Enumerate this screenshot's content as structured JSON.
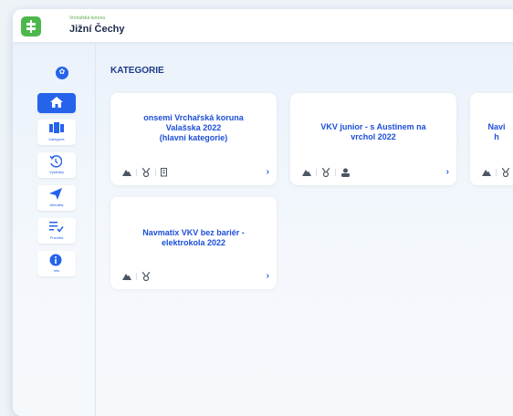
{
  "header": {
    "region_small": "Vrchařská koruna",
    "region_title": "Jižní Čechy"
  },
  "sidebar": {
    "items": [
      {
        "label": ""
      },
      {
        "label": "Kategorie"
      },
      {
        "label": "Výsledky"
      },
      {
        "label": "Aktuality"
      },
      {
        "label": "Pravidla"
      },
      {
        "label": "Info"
      }
    ]
  },
  "main": {
    "title": "KATEGORIE",
    "cards": [
      {
        "title_lines": [
          "onsemi Vrchařská koruna",
          "Valašska 2022",
          "(hlavní kategorie)"
        ]
      },
      {
        "title_lines": [
          "VKV junior - s Austinem na",
          "vrchol 2022"
        ]
      },
      {
        "title_lines": [
          "Navi",
          "h"
        ]
      },
      {
        "title_lines": [
          "Navmatix VKV bez bariér -",
          "elektrokola 2022"
        ]
      }
    ],
    "chevron": "›"
  },
  "colors": {
    "accent": "#2563eb",
    "brand_green": "#4cb84c",
    "title_dark": "#1c2a4a"
  }
}
